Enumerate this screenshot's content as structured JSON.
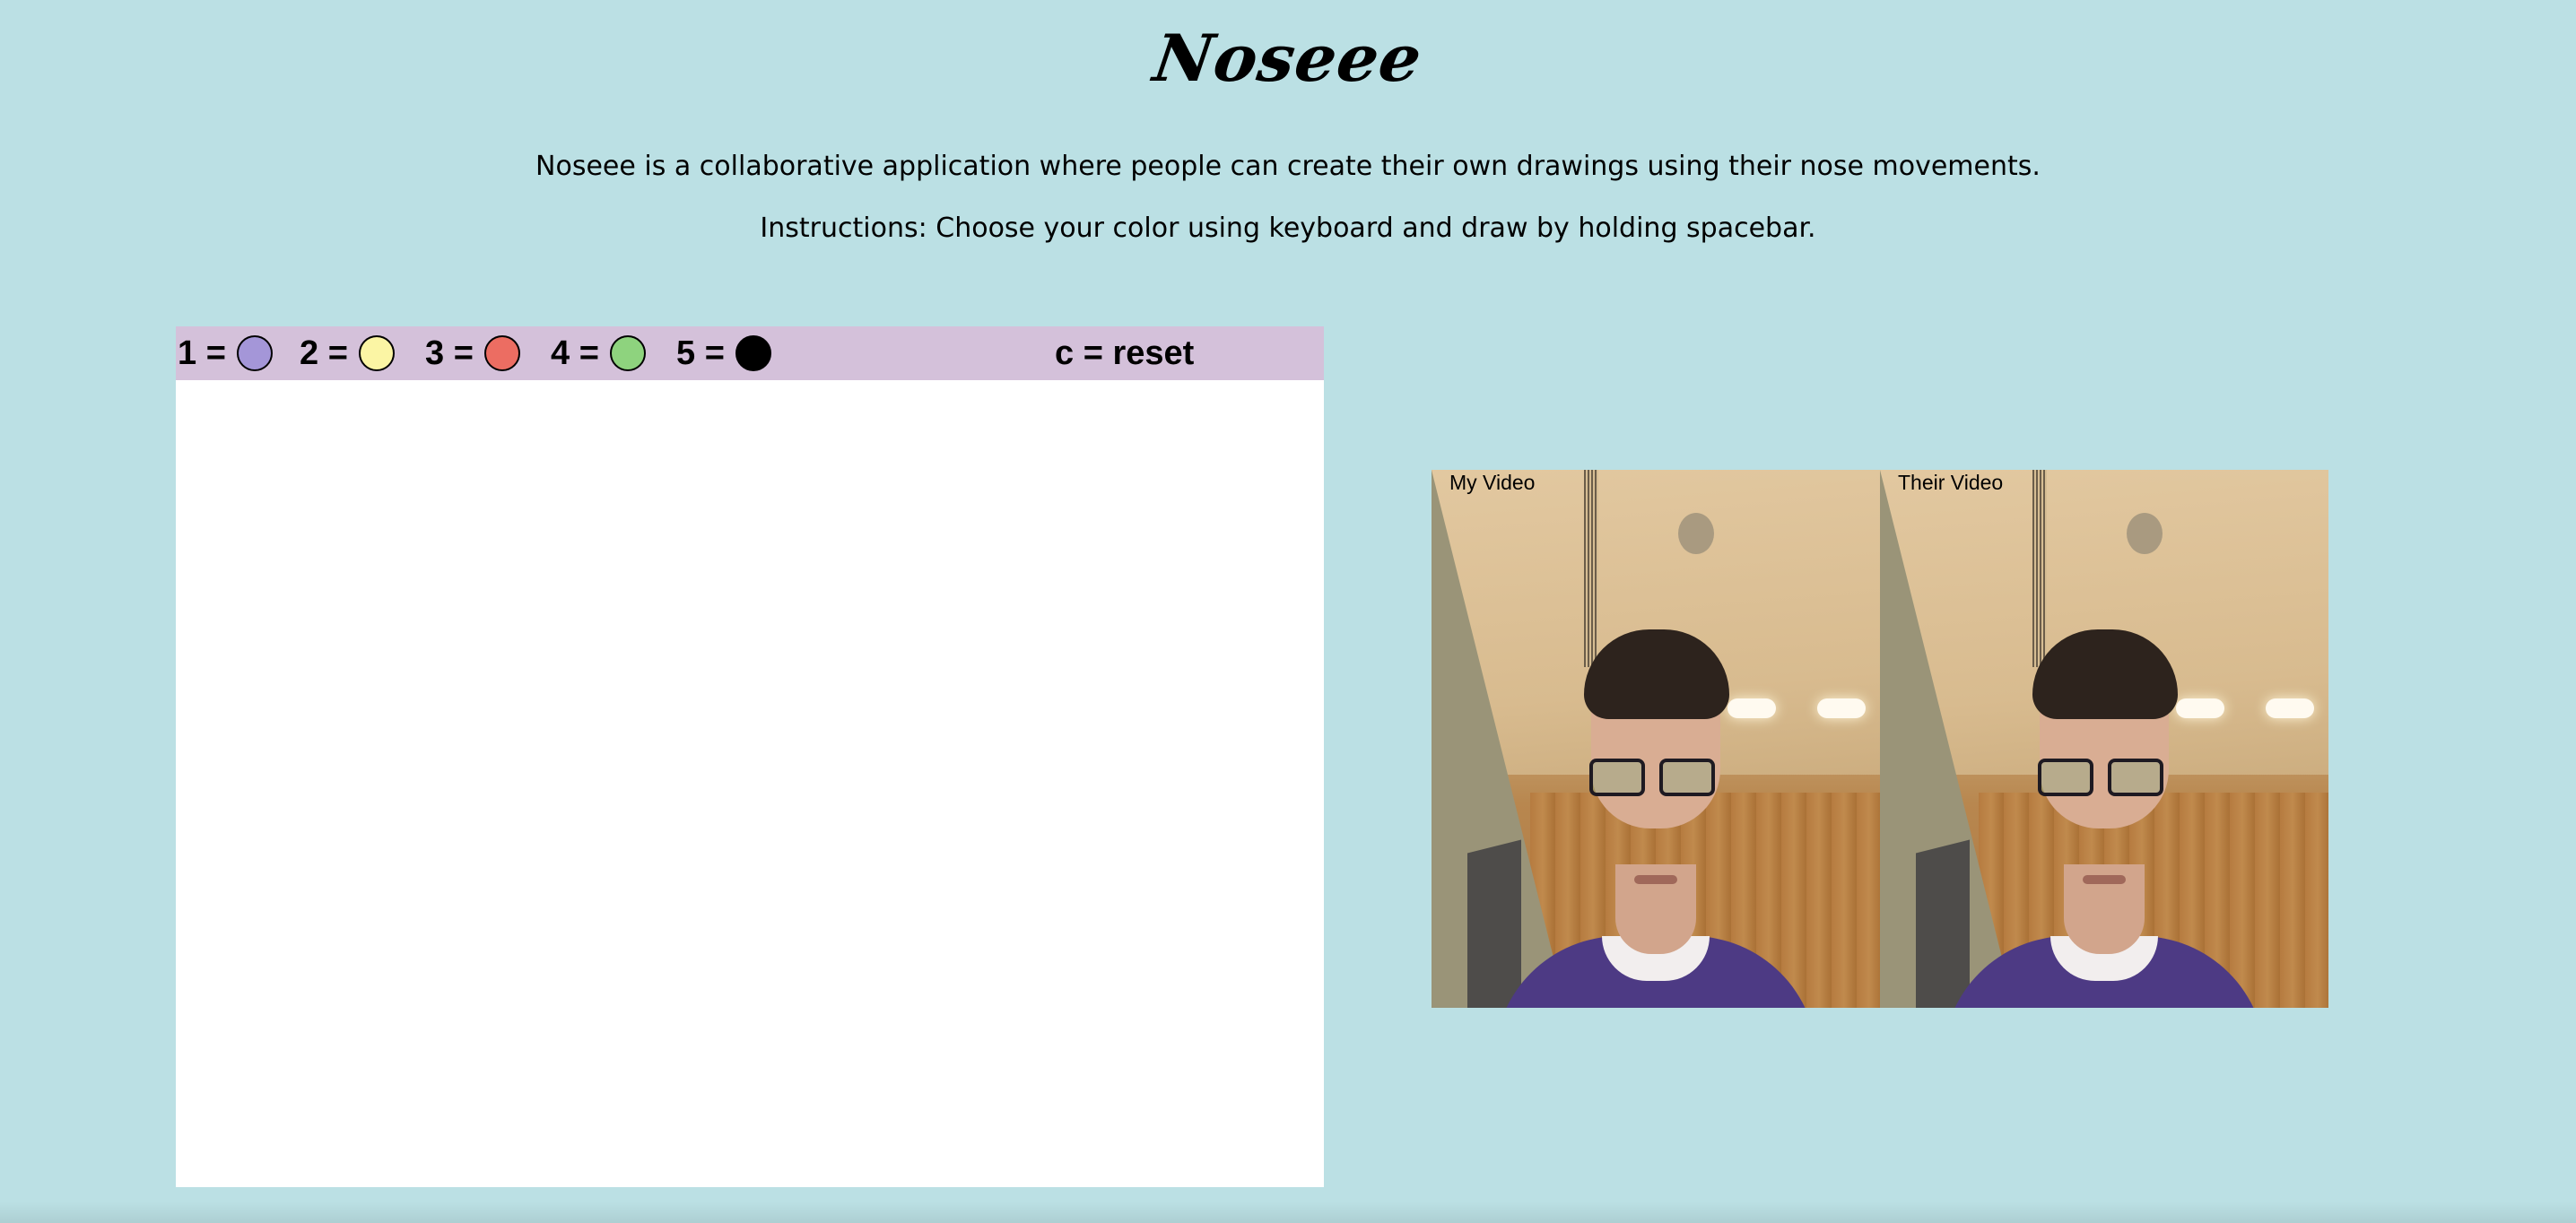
{
  "app": {
    "title": "Noseee",
    "description": "Noseee is a collaborative application where people can create their own drawings using their nose movements.",
    "instructions": "Instructions: Choose your color using keyboard and draw by holding spacebar."
  },
  "toolbar": {
    "keys": [
      {
        "label": "1 =",
        "color": "#a496d8"
      },
      {
        "label": "2 =",
        "color": "#fbf5a4"
      },
      {
        "label": "3 =",
        "color": "#ec6d62"
      },
      {
        "label": "4 =",
        "color": "#8ed37e"
      },
      {
        "label": "5 =",
        "color": "#000000"
      }
    ],
    "reset_label": "c = reset",
    "background": "#d4c1da"
  },
  "videos": {
    "mine_label": "My Video",
    "theirs_label": "Their Video"
  },
  "colors": {
    "page_background": "#bbe0e4",
    "canvas_background": "#ffffff"
  }
}
